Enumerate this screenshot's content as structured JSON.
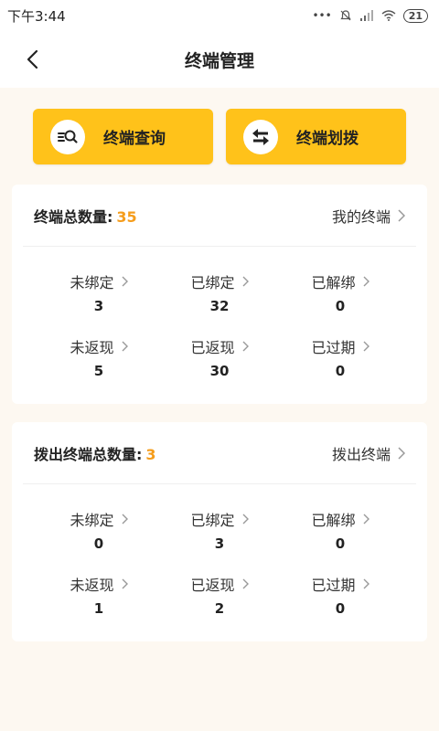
{
  "status_bar": {
    "time": "下午3:44",
    "signal_dots": "•••",
    "battery": "21"
  },
  "header": {
    "title": "终端管理"
  },
  "actions": [
    {
      "label": "终端查询",
      "icon": "search-list-icon"
    },
    {
      "label": "终端划拨",
      "icon": "transfer-arrows-icon"
    }
  ],
  "my_terminals": {
    "summary_label": "终端总数量:",
    "summary_value": "35",
    "link_label": "我的终端",
    "stats": [
      {
        "label": "未绑定",
        "value": "3"
      },
      {
        "label": "已绑定",
        "value": "32"
      },
      {
        "label": "已解绑",
        "value": "0"
      },
      {
        "label": "未返现",
        "value": "5"
      },
      {
        "label": "已返现",
        "value": "30"
      },
      {
        "label": "已过期",
        "value": "0"
      }
    ]
  },
  "allocated_terminals": {
    "summary_label": "拨出终端总数量:",
    "summary_value": "3",
    "link_label": "拨出终端",
    "stats": [
      {
        "label": "未绑定",
        "value": "0"
      },
      {
        "label": "已绑定",
        "value": "3"
      },
      {
        "label": "已解绑",
        "value": "0"
      },
      {
        "label": "未返现",
        "value": "1"
      },
      {
        "label": "已返现",
        "value": "2"
      },
      {
        "label": "已过期",
        "value": "0"
      }
    ]
  },
  "colors": {
    "accent": "#ffc21a",
    "count_highlight": "#f59d1c",
    "background": "#fdf8f1"
  }
}
